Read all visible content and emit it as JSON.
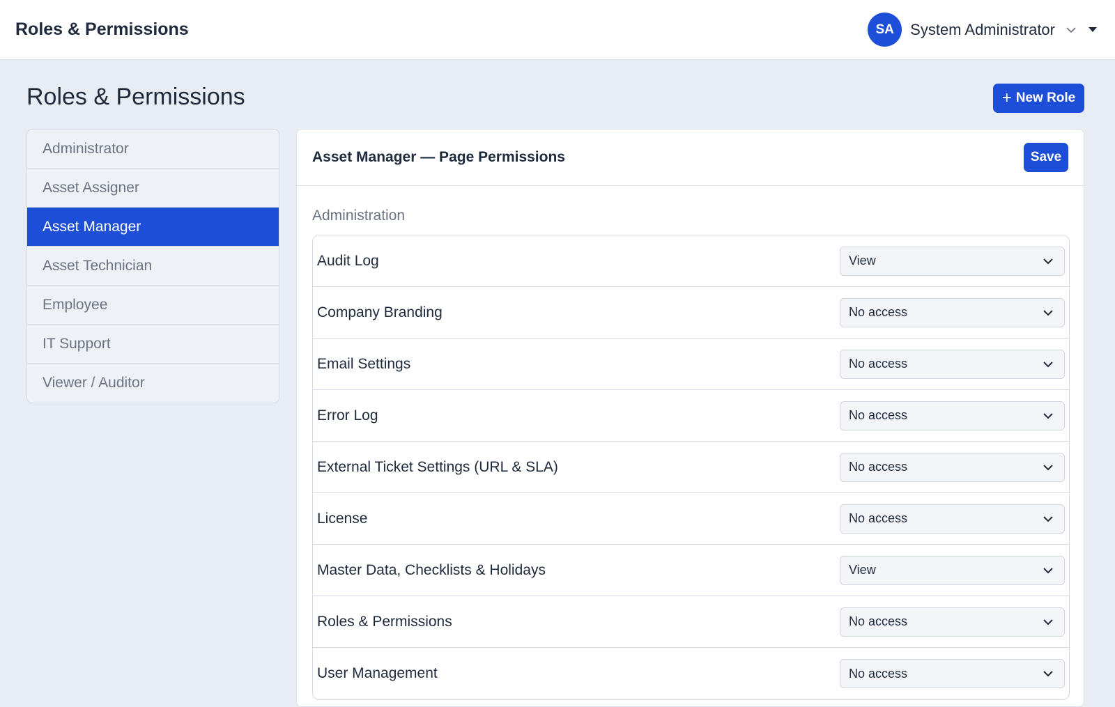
{
  "header": {
    "app_title": "Roles & Permissions",
    "user": {
      "initials": "SA",
      "name": "System Administrator"
    }
  },
  "page": {
    "title": "Roles & Permissions",
    "new_role_label": "New Role"
  },
  "roles": [
    {
      "label": "Administrator",
      "active": false
    },
    {
      "label": "Asset Assigner",
      "active": false
    },
    {
      "label": "Asset Manager",
      "active": true
    },
    {
      "label": "Asset Technician",
      "active": false
    },
    {
      "label": "Employee",
      "active": false
    },
    {
      "label": "IT Support",
      "active": false
    },
    {
      "label": "Viewer / Auditor",
      "active": false
    }
  ],
  "panel": {
    "title": "Asset Manager — Page Permissions",
    "save_label": "Save",
    "section": "Administration",
    "permissions": [
      {
        "page": "Audit Log",
        "access": "View"
      },
      {
        "page": "Company Branding",
        "access": "No access"
      },
      {
        "page": "Email Settings",
        "access": "No access"
      },
      {
        "page": "Error Log",
        "access": "No access"
      },
      {
        "page": "External Ticket Settings (URL & SLA)",
        "access": "No access"
      },
      {
        "page": "License",
        "access": "No access"
      },
      {
        "page": "Master Data, Checklists & Holidays",
        "access": "View"
      },
      {
        "page": "Roles & Permissions",
        "access": "No access"
      },
      {
        "page": "User Management",
        "access": "No access"
      }
    ]
  },
  "colors": {
    "accent": "#1d4ed8",
    "page_background": "#e8edf4"
  }
}
